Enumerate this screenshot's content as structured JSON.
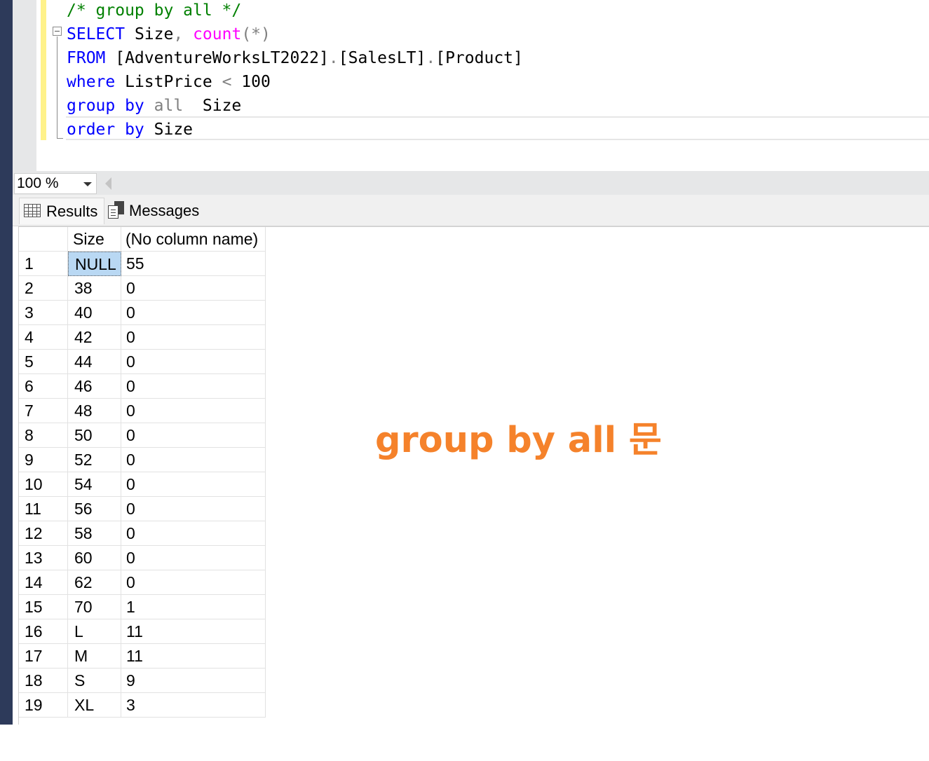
{
  "editor": {
    "lines": [
      {
        "parts": [
          {
            "t": "/* group by all */",
            "c": "cmt"
          }
        ]
      },
      {
        "parts": [
          {
            "t": "SELECT",
            "c": "kw"
          },
          {
            "t": " Size",
            "c": ""
          },
          {
            "t": ",",
            "c": "gray"
          },
          {
            "t": " ",
            "c": ""
          },
          {
            "t": "count",
            "c": "fn"
          },
          {
            "t": "(*)",
            "c": "gray"
          }
        ]
      },
      {
        "parts": [
          {
            "t": "FROM",
            "c": "kw"
          },
          {
            "t": " [AdventureWorksLT2022]",
            "c": ""
          },
          {
            "t": ".",
            "c": "gray"
          },
          {
            "t": "[SalesLT]",
            "c": ""
          },
          {
            "t": ".",
            "c": "gray"
          },
          {
            "t": "[Product]",
            "c": ""
          }
        ]
      },
      {
        "parts": [
          {
            "t": "where",
            "c": "kw"
          },
          {
            "t": " ListPrice ",
            "c": ""
          },
          {
            "t": "<",
            "c": "gray"
          },
          {
            "t": " 100",
            "c": ""
          }
        ]
      },
      {
        "parts": [
          {
            "t": "group by",
            "c": "kw"
          },
          {
            "t": " ",
            "c": ""
          },
          {
            "t": "all",
            "c": "gray"
          },
          {
            "t": "  Size",
            "c": ""
          }
        ]
      },
      {
        "parts": [
          {
            "t": "order by",
            "c": "kw"
          },
          {
            "t": " Size",
            "c": ""
          }
        ]
      }
    ]
  },
  "zoom": {
    "value": "100 %"
  },
  "tabs": {
    "results": "Results",
    "messages": "Messages"
  },
  "results": {
    "columns": [
      "Size",
      "(No column name)"
    ],
    "rows": [
      [
        "1",
        "NULL",
        "55"
      ],
      [
        "2",
        "38",
        "0"
      ],
      [
        "3",
        "40",
        "0"
      ],
      [
        "4",
        "42",
        "0"
      ],
      [
        "5",
        "44",
        "0"
      ],
      [
        "6",
        "46",
        "0"
      ],
      [
        "7",
        "48",
        "0"
      ],
      [
        "8",
        "50",
        "0"
      ],
      [
        "9",
        "52",
        "0"
      ],
      [
        "10",
        "54",
        "0"
      ],
      [
        "11",
        "56",
        "0"
      ],
      [
        "12",
        "58",
        "0"
      ],
      [
        "13",
        "60",
        "0"
      ],
      [
        "14",
        "62",
        "0"
      ],
      [
        "15",
        "70",
        "1"
      ],
      [
        "16",
        "L",
        "11"
      ],
      [
        "17",
        "M",
        "11"
      ],
      [
        "18",
        "S",
        "9"
      ],
      [
        "19",
        "XL",
        "3"
      ]
    ]
  },
  "overlay": {
    "text": "group by all 문",
    "color": "#f5822b"
  },
  "colors": {
    "keyword": "#0000ff",
    "function": "#ff00ff",
    "comment": "#008000",
    "operator": "#808080",
    "selection": "#b9d8f3"
  }
}
